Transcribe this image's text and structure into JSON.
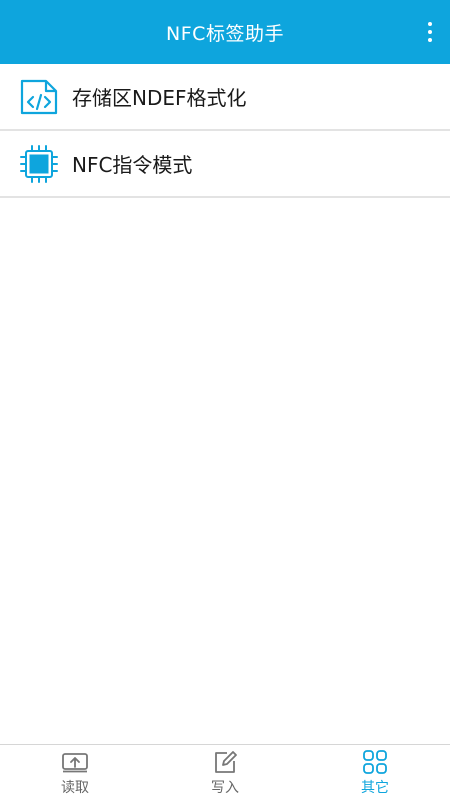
{
  "app_bar": {
    "title": "NFC标签助手",
    "menu_icon": "more-vertical-icon"
  },
  "list": {
    "items": [
      {
        "label": "存储区NDEF格式化",
        "icon": "code-file-icon"
      },
      {
        "label": "NFC指令模式",
        "icon": "chip-icon"
      }
    ]
  },
  "bottom_nav": {
    "items": [
      {
        "label": "读取",
        "icon": "read-tray-icon",
        "active": false
      },
      {
        "label": "写入",
        "icon": "edit-icon",
        "active": false
      },
      {
        "label": "其它",
        "icon": "grid-icon",
        "active": true
      }
    ]
  },
  "colors": {
    "accent": "#0ea5dd",
    "text": "#1a1a1a",
    "inactive": "#666666"
  }
}
